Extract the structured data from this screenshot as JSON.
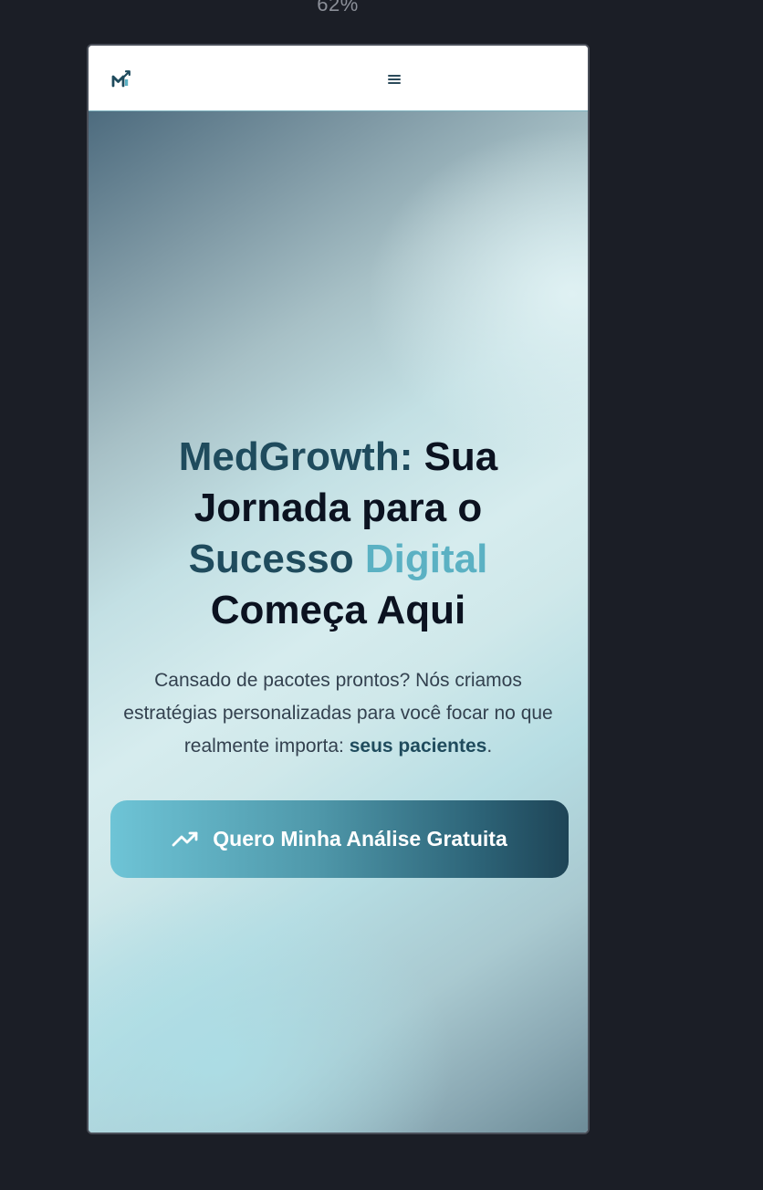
{
  "viewport": {
    "zoom_label": "62%"
  },
  "header": {
    "logo_icon": "chart-growth-logo-icon",
    "menu_icon": "hamburger-menu-icon"
  },
  "hero": {
    "title": {
      "part1": "MedGrowth:",
      "part2": " Sua Jornada para o ",
      "part3": "Sucesso",
      "part4": " ",
      "part5": "Digital",
      "part6": " Começa Aqui"
    },
    "subtitle": {
      "text": "Cansado de pacotes prontos? Nós criamos estratégias personalizadas para você focar no que realmente importa: ",
      "emphasis": "seus pacientes",
      "end": "."
    },
    "cta": {
      "icon": "trending-up-icon",
      "label": "Quero Minha Análise Gratuita"
    }
  },
  "colors": {
    "page_background": "#1b1e26",
    "brand_dark": "#1f4b5d",
    "brand_light": "#5bb1c3",
    "heading": "#0b1220",
    "body_text": "#33414f",
    "cta_gradient_start": "#6ec4d6",
    "cta_gradient_end": "#1e4456"
  }
}
